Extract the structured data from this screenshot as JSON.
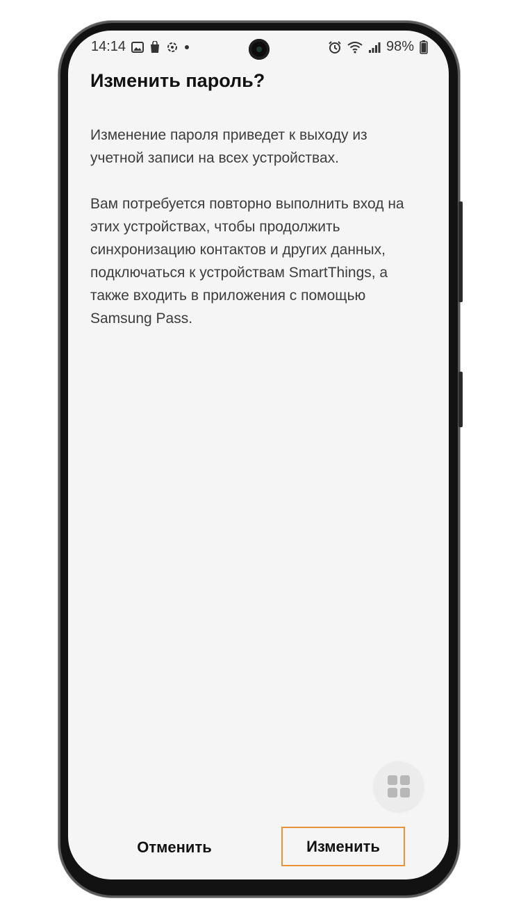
{
  "status_bar": {
    "time": "14:14",
    "left_icons": [
      "gallery-icon",
      "shopping-bag-icon",
      "sync-icon",
      "dot-icon"
    ],
    "right_icons": [
      "alarm-icon",
      "wifi-icon",
      "signal-icon"
    ],
    "battery_percent": "98%",
    "battery_level": 0.98
  },
  "dialog": {
    "title": "Изменить пароль?",
    "paragraph_1": "Изменение пароля приведет к выходу из учетной записи на всех устройствах.",
    "paragraph_2": "Вам потребуется повторно выполнить вход на этих устройствах, чтобы продолжить синхронизацию контактов и других данных, подключаться к устройствам SmartThings, а также входить в приложения с помощью Samsung Pass.",
    "cancel_label": "Отменить",
    "confirm_label": "Изменить"
  },
  "floating_button": {
    "icon": "apps-grid-icon"
  },
  "colors": {
    "highlight": "#e8933a",
    "screen_background": "#f5f5f5"
  }
}
